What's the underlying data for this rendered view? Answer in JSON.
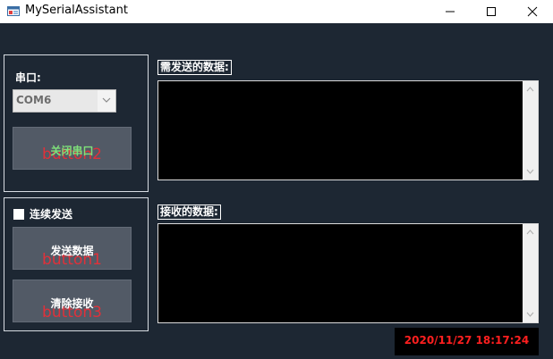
{
  "window": {
    "title": "MySerialAssistant",
    "minimize_glyph": "—",
    "maximize_glyph": "☐",
    "close_glyph": "✕"
  },
  "serial_group": {
    "port_label": "串口:",
    "port_value": "COM6",
    "toggle_button": {
      "label": "关闭串口",
      "watermark": "button2"
    }
  },
  "send_group": {
    "continuous_label": "连续发送",
    "continuous_checked": false,
    "send_button": {
      "label": "发送数据",
      "watermark": "button1"
    },
    "clear_button": {
      "label": "清除接收",
      "watermark": "button3"
    }
  },
  "send_panel": {
    "label": "需发送的数据:",
    "value": ""
  },
  "receive_panel": {
    "label": "接收的数据:",
    "value": ""
  },
  "status": {
    "datetime": "2020/11/27 18:17:24"
  },
  "colors": {
    "background": "#1d2733",
    "button": "#525a66",
    "toggle_label": "#7fe07a",
    "watermark": "#e0313a",
    "datetime": "#ff1f1f"
  },
  "icons": {
    "app": "serial-app-icon",
    "dropdown": "chevron-down-icon",
    "scroll_up": "chevron-up-icon",
    "scroll_down": "chevron-down-icon"
  }
}
